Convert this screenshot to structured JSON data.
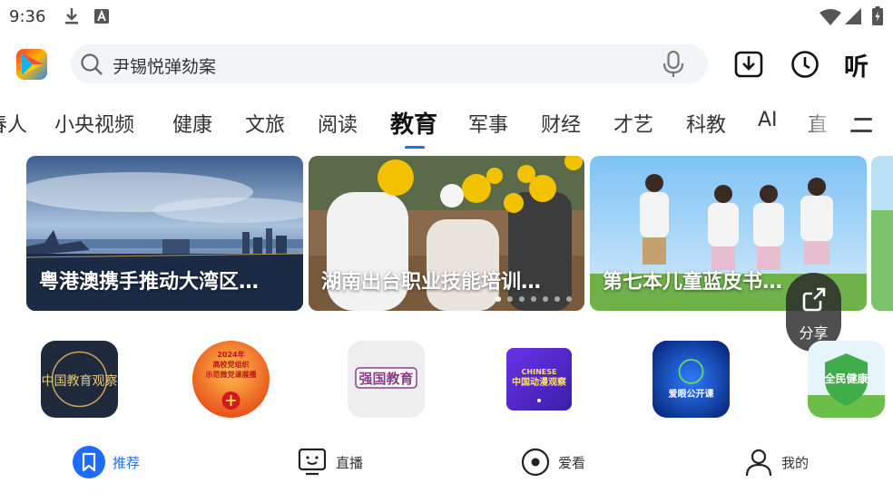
{
  "status_bar": {
    "time": "9:36",
    "icons": [
      "download-icon",
      "text-icon",
      "wifi-icon",
      "signal-icon",
      "battery-icon"
    ]
  },
  "search": {
    "query": "尹锡悦弹劾案",
    "icons": [
      "search-icon",
      "mic-icon"
    ]
  },
  "header": {
    "actions": [
      "download-icon",
      "history-clock-icon"
    ],
    "listen_label": "听"
  },
  "tabs": {
    "items": [
      "春人",
      "小央视频",
      "健康",
      "文旅",
      "阅读",
      "教育",
      "军事",
      "财经",
      "才艺",
      "科教",
      "AI",
      "直"
    ],
    "active": "教育"
  },
  "banners": [
    {
      "caption": "粤港澳携手推动大湾区…"
    },
    {
      "caption": "湖南出台职业技能培训…"
    },
    {
      "caption": "第七本儿童蓝皮书…"
    }
  ],
  "carousel": {
    "count": 7,
    "active_index": 0
  },
  "share": {
    "label": "分享"
  },
  "channels": [
    {
      "name": "中国教育观察",
      "logo_text": "中国教育观察"
    },
    {
      "name": "2024年高校党组织示范微党课展播",
      "logo_text_line1": "2024年",
      "logo_text_line2": "高校党组织",
      "logo_text_line3": "示范微党课展播"
    },
    {
      "name": "强国教育",
      "logo_text": "强国教育"
    },
    {
      "name": "中国动漫观察",
      "logo_text_top": "CHINESE",
      "logo_text": "中国动漫观察"
    },
    {
      "name": "爱眼公开课",
      "logo_text": "爱眼公开课"
    },
    {
      "name": "全民健康",
      "logo_text": "全民健康"
    }
  ],
  "bottom_nav": [
    {
      "label": "推荐",
      "icon": "bookmark-icon",
      "active": true
    },
    {
      "label": "直播",
      "icon": "tv-icon",
      "active": false
    },
    {
      "label": "爱看",
      "icon": "target-icon",
      "active": false
    },
    {
      "label": "我的",
      "icon": "person-icon",
      "active": false
    }
  ],
  "colors": {
    "accent": "#1e6bff"
  }
}
